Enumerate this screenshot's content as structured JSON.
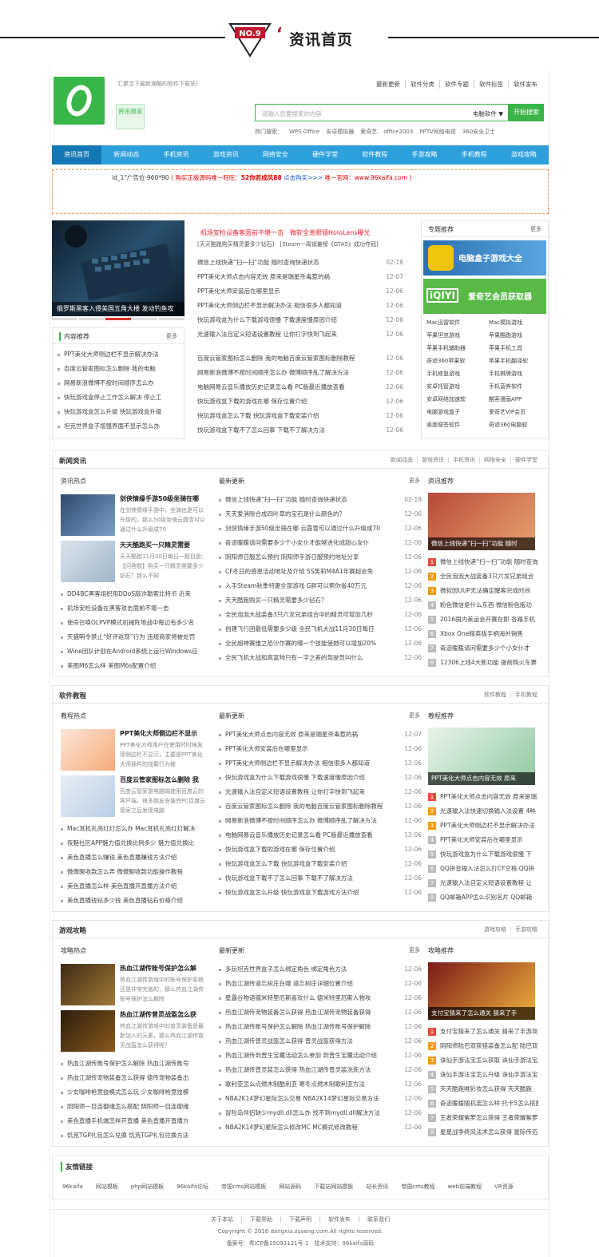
{
  "banner": {
    "number": "NO.9",
    "quote": "‘",
    "title": "资讯首页"
  },
  "header": {
    "slogan": "汇聚当下最新潮酷的软件下载站！",
    "topnav": [
      "最新更新",
      "软件分类",
      "软件专题",
      "软件标签",
      "软件发布"
    ],
    "channel_btn": "资讯频道",
    "search_placeholder": "请输入您要搜索的内容",
    "search_select": "电脑软件 ▼",
    "search_btn": "开始搜索",
    "hot_label": "热门搜索：",
    "hot": [
      "WPS Office",
      "安卓模拟器",
      "爱奇艺",
      "office2003",
      "PPTV网络电视",
      "360安全卫士"
    ]
  },
  "nav": [
    "资讯首页",
    "新闻动态",
    "手机资讯",
    "游戏资讯",
    "网络安全",
    "硬件学堂",
    "软件教程",
    "手游攻略",
    "手机教程",
    "游戏攻略"
  ],
  "ad": {
    "id": "id_1\"广告位-960*90",
    "p1": "( 购买正版源码唯一旺旺：",
    "p2": "52你若成风88",
    "p3": "点击购买>>>",
    "p4": "唯一官网：www.96kaifa.com )"
  },
  "slider": {
    "caption": "俄罗斯黑客入侵美国五角大楼 发动钓鱼攻"
  },
  "headline": {
    "l1": "机场安检设备客面前不堪一击　微软全息眼镜HoloLens曝光",
    "l2": "[天天酷跑购买精灵要多少钻石]　[Steam一周销量榜《GTA5》成功夺冠]"
  },
  "topnews": [
    {
      "t": "微信上线快递“扫一扫”功能 随时查询快递状态",
      "d": "02-18"
    },
    {
      "t": "PPT美化大师点击内容无效 原来是瑞星杀毒惹的祸",
      "d": "12-07"
    },
    {
      "t": "PPT美化大师安装后在哪里显示",
      "d": "12-06"
    },
    {
      "t": "PPT美化大师侧边栏不显示解决办法 相信很多人都知道",
      "d": "12-06"
    },
    {
      "t": "快玩游戏盒为什么下载游戏很慢 下载速度慢原因介绍",
      "d": "12-06"
    },
    {
      "t": "光速输入法自定义短语设置教程 让你打字快到飞起来",
      "d": "12-06"
    }
  ],
  "topnews2": [
    {
      "t": "百度云管家图标怎么删除 我的电脑百度云管家图标删除教程",
      "d": "12-06"
    },
    {
      "t": "网易新浪微博不按时间顺序怎么办 微博顺序乱了解决方法",
      "d": "12-06"
    },
    {
      "t": "电脑网易云音乐播放历史记录怎么看 PC版最近播放查看",
      "d": "12-06"
    },
    {
      "t": "快玩游戏盒下载的游戏在哪 保存位置介绍",
      "d": "12-06"
    },
    {
      "t": "快玩游戏盒怎么下载 快玩游戏盒下载安装介绍",
      "d": "12-06"
    },
    {
      "t": "快玩游戏盒下载不了怎么回事 下载不了解决方法",
      "d": "12-06"
    }
  ],
  "content_rec": {
    "title": "内容推荐",
    "more": "更多",
    "items": [
      "PPT美化大师侧边栏不显示解决办法",
      "百度云管家图标怎么删除 我的电脑",
      "网易新浪微博不按时间顺序怎么办",
      "快玩游戏盒停止工作怎么解决 停止工",
      "快玩游戏盒怎么升级 快玩游戏盒升级",
      "坦克世界盒子增强界面不显示怎么办"
    ]
  },
  "topic": {
    "title": "专题推荐",
    "more": "更多",
    "img1": "电脑盒子游戏大全",
    "img2a": "iQIYI",
    "img2b": "爱奇艺会员获取器",
    "items": [
      "Mac迅雷软件",
      "Mac模拟游戏",
      "苹果坦克游戏",
      "苹果酷跑游戏",
      "苹果手机辅助器",
      "苹果手机工具",
      "奇迹360苹果软",
      "苹果手机翻译软",
      "手机修复游戏",
      "手机棋牌游戏",
      "安卓托管游戏",
      "手机营养软件",
      "安卓网络加速软",
      "酷客漫画APP",
      "电脑游戏盒子",
      "爱奇艺VIP会员",
      "桌面便签软件",
      "奇迹360电脑软"
    ]
  },
  "news": {
    "title": "新闻资讯",
    "tabs": [
      "新闻动态",
      "游戏资讯",
      "手机资讯",
      "网络安全",
      "硬件学堂"
    ],
    "hot": "资讯热点",
    "latest": "最新更新",
    "more": "更多",
    "rec": "资讯推荐",
    "f1t": "剑侠情缘手游50级坐骑在哪",
    "f1d": "在剑侠情缘手游中，坐骑也是可以升级的，那么50级坐骑云霞雪可以通过什么升级成70",
    "f2t": "天天酷跑买一只精灵需要",
    "f2d": "天天酷跑11月30日每日一题目是：【问答题】购买一只精灵需要多少钻石？那么不知",
    "list": [
      "DD4BC黑客组织用DDoS敲诈勒索比特币 近来",
      "机场安检设备在黑客攻击面前不堪一击",
      "使命召唤OLPVP模式机械阵地战中每边有多少名",
      "天猫明令禁止“好评返现”行为 违规商家将被处罚",
      "Wine团队计划在Android系统上运行Windows应",
      "美图M6怎么样 美图M6s配置介绍"
    ],
    "latest_list": [
      {
        "t": "微信上线快递“扫一扫”功能 随时查询快递状态",
        "d": "02-18"
      },
      {
        "t": "天天爱消除合成四叶草的宝石是什么颜色的？",
        "d": "12-06"
      },
      {
        "t": "剑侠情缘手游50级坐骑在哪 云霞雪可以通过什么升级成70",
        "d": "12-06"
      },
      {
        "t": "奇迹暖暖请问需要多少个小女仆才能够进化成甜心女仆",
        "d": "12-06"
      },
      {
        "t": "阴阳师日服怎么预约 阴阳师手游日服预约地址分享",
        "d": "12-06"
      },
      {
        "t": "CF冬日的感恩活动地址及介绍 SS笑莉M4A1年赛超会免",
        "d": "12-06"
      },
      {
        "t": "入手Steam秋季特惠全部游戏 G胖可以帮你省40万元",
        "d": "12-06"
      },
      {
        "t": "天天酷跑购买一只精灵需要多少钻石？",
        "d": "12-06"
      },
      {
        "t": "全民泡泡大战装备3只六龙兄弟组合中的精灵可增加几秒",
        "d": "12-06"
      },
      {
        "t": "创建飞行团最低需要多少级 全民飞机大战11月30日每日",
        "d": "12-06"
      },
      {
        "t": "全民超神赛维之恐沙尔赛的哪一个技能使她可以增加20%",
        "d": "12-06"
      },
      {
        "t": "全民飞机大战和高富帅只有一字之差的驾驶员叫什么",
        "d": "12-06"
      }
    ],
    "rec_img": "微信上线快递“扫一扫”功能 随时",
    "rank": [
      "微信上线快递“扫一扫”功能 随时查询",
      "全民泡泡大战装备3只六龙兄弟组合",
      "微软因UUP无法确定醒客完成时间",
      "粉色微信是什么东西 微信粉色版功",
      "2016国内美运会开赛在即 各路手机",
      "Xbox One精英版手柄海外销售",
      "奇迹暖暖请问需要多少个小女仆才",
      "12306上线4大新功能 提前购火车票"
    ]
  },
  "soft": {
    "title": "软件教程",
    "tabs": [
      "软件教程",
      "手机教程"
    ],
    "hot": "教程热点",
    "latest": "最新更新",
    "more": "更多",
    "rec": "教程推荐",
    "f1t": "PPT美化大师侧边栏不显示",
    "f1d": "PPT美化大师用户在使用时时候发现侧边栏不显示，主要是PPT美化大师插件的加载行为被",
    "f2t": "百度云管家图标怎么删除 我",
    "f2d": "百度云管家是电脑端使用百度云的客户端，很多朋友安装完PC百度云管家之后发现电脑",
    "list": [
      "Mac耳机孔亮红灯怎么办 Mac耳机孔亮红灯解决",
      "夜魅社区APP魅力值兑换比例多少 魅力值兑换比",
      "美色直播怎么赚钱 美色直播赚钱方法介绍",
      "微微聊收款怎么弄 微微聊收款功能操作教程",
      "美色直播怎么样 美色直播开直播方法介绍",
      "美色直播钱钻多少钱 美色直播钻石价格介绍"
    ],
    "latest_list": [
      {
        "t": "PPT美化大师点击内容无效 原来是瑞星杀毒惹的祸",
        "d": "12-07"
      },
      {
        "t": "PPT美化大师安装后在哪里显示",
        "d": "12-06"
      },
      {
        "t": "PPT美化大师侧边栏不显示解决办法 相信很多人都知道",
        "d": "12-06"
      },
      {
        "t": "快玩游戏盒为什么下载游戏很慢 下载速度慢原因介绍",
        "d": "12-06"
      },
      {
        "t": "光速输入法自定义短语设置教程 让你打字快到飞起来",
        "d": "12-06"
      },
      {
        "t": "百度云管家图标怎么删除 我的电脑百度云管家图标删除教程",
        "d": "12-06"
      },
      {
        "t": "网易新浪微博不按时间顺序怎么办 微博顺序乱了解决方法",
        "d": "12-06"
      },
      {
        "t": "电脑网易云音乐播放历史记录怎么看 PC版最近播放查看",
        "d": "12-06"
      },
      {
        "t": "快玩游戏盒下载的游戏在哪 保存位置介绍",
        "d": "12-06"
      },
      {
        "t": "快玩游戏盒怎么下载 快玩游戏盒下载安装介绍",
        "d": "12-06"
      },
      {
        "t": "快玩游戏盒下载不了怎么回事 下载不了解决方法",
        "d": "12-06"
      },
      {
        "t": "快玩游戏盒怎么升级 快玩游戏盒下载游戏方法介绍",
        "d": "12-06"
      }
    ],
    "rec_img": "PPT美化大师点击内容无效 原来",
    "rank": [
      "PPT美化大师点击内容无效 原来是瑞",
      "光速输入法快速切换输入法设置 4种",
      "PPT美化大师侧边栏不显示解决办法",
      "PPT美化大师安装后在哪里显示",
      "快玩游戏盒为什么下载游戏很慢 下",
      "QQ拼音输入法怎么打CF空格 QQ拼",
      "光速输入法自定义短语设置教程 让",
      "QQ邮箱APP怎么识别名片 QQ邮箱"
    ]
  },
  "game": {
    "title": "游戏攻略",
    "tabs": [
      "游戏攻略",
      "手游攻略"
    ],
    "hot": "攻略热点",
    "latest": "最新更新",
    "more": "更多",
    "rec": "攻略推荐",
    "f1t": "热血江湖传账号保护怎么解",
    "f1d": "热血江湖传游戏中的账号保护系统还是非常完善的，那么热血江湖传账号保护怎么解除",
    "f2t": "热血江湖传曾灵战盔怎么获",
    "f2d": "热血江湖传游戏中的曾灵装备是最新加入的元素，那么热血江湖传曾灵战盔怎么获得呢？",
    "list": [
      "热血江湖传账号保护怎么解除 热血江湖传账号",
      "热血江湖传宠物装备怎么获得 德传宠物装备出",
      "少女咖啡枪竞技模式怎么玩 少女咖啡枪竞技模",
      "阴阳师一目连御魂怎么搭配 阴阳师一目连御魂",
      "美色直播手机端怎样开直播 美色直播开直播方",
      "饥荒TGP礼包怎么兑换 饥荒TGP礼包兑换方法"
    ],
    "latest_list": [
      {
        "t": "多玩坦克世界盒子怎么绑定角色 绑定角色方法",
        "d": "12-06"
      },
      {
        "t": "热血江湖传道忘树庄在哪 道忘树庄详细位置介绍",
        "d": "12-06"
      },
      {
        "t": "星露谷物语德米特里厄斯喜欢什么 德米特里厄斯人物攻",
        "d": "12-06"
      },
      {
        "t": "热血江湖传宠物装备怎么获得 热血江湖传宠物装备获得",
        "d": "12-06"
      },
      {
        "t": "热血江湖传账号保护怎么解除 热血江湖传账号保护解除",
        "d": "12-06"
      },
      {
        "t": "热血江湖传曾灵战盔怎么获得 曾灵战盔获得方法",
        "d": "12-06"
      },
      {
        "t": "热血江湖传到曾生宝藏活动怎么参加 到曾生宝藏活动介绍",
        "d": "12-06"
      },
      {
        "t": "热血江湖传曾灵装怎么获得 热血江湖传曾灵装洗炼方法",
        "d": "12-06"
      },
      {
        "t": "歌利亚怎么点燃木制酷利亚 寒冬点燃木制歌利亚方法",
        "d": "12-06"
      },
      {
        "t": "NBA2K14梦幻星际怎么交易 NBA2K14梦幻星际交易方法",
        "d": "12-06"
      },
      {
        "t": "冒险岛伴侣缺少mydll.dll怎么办 找不到mydll.dll解决方法",
        "d": "12-06"
      },
      {
        "t": "NBA2K14梦幻星际怎么修改MC MC模式修改教程",
        "d": "12-06"
      }
    ],
    "rec_img": "支付宝猜来了怎么通关 猜来了手",
    "rank": [
      "支付宝猜来了怎么通关 猜来了手游攻",
      "阴阳师陆巴双获猎装备怎么配 陆巴双",
      "诛仙手游法宝怎么获取 诛仙手游法宝",
      "诛仙手游法宝怎么升级 诛仙手游法宝",
      "天天酷跑唯彩妆怎么获得 天天酷跑",
      "奇迹暖暖随机装怎么样 托卡5怎么搭配",
      "王者荣耀紫萝怎么获得 王者荣耀紫萝",
      "星星战争终风法术怎么获得 星际传迈"
    ]
  },
  "friend": {
    "title": "友情链接",
    "links": [
      "96kaifa",
      "网站模板",
      "php网站模板",
      "96kaifa论坛",
      "帝国cms网站模板",
      "网站源码",
      "下载站网站模板",
      "站长资讯",
      "帝国cms教程",
      "web前端教程",
      "VR资源"
    ]
  },
  "footer": {
    "links": [
      "关于本站",
      "下载帮助",
      "下载声明",
      "软件发布",
      "联系我们"
    ],
    "copy": "Copyright © 2016 dangxia.zuseng.com.All rights reserved.",
    "icp": "备案号：粤ICP备15093131号-1　技术支持：96kaifa源码"
  }
}
